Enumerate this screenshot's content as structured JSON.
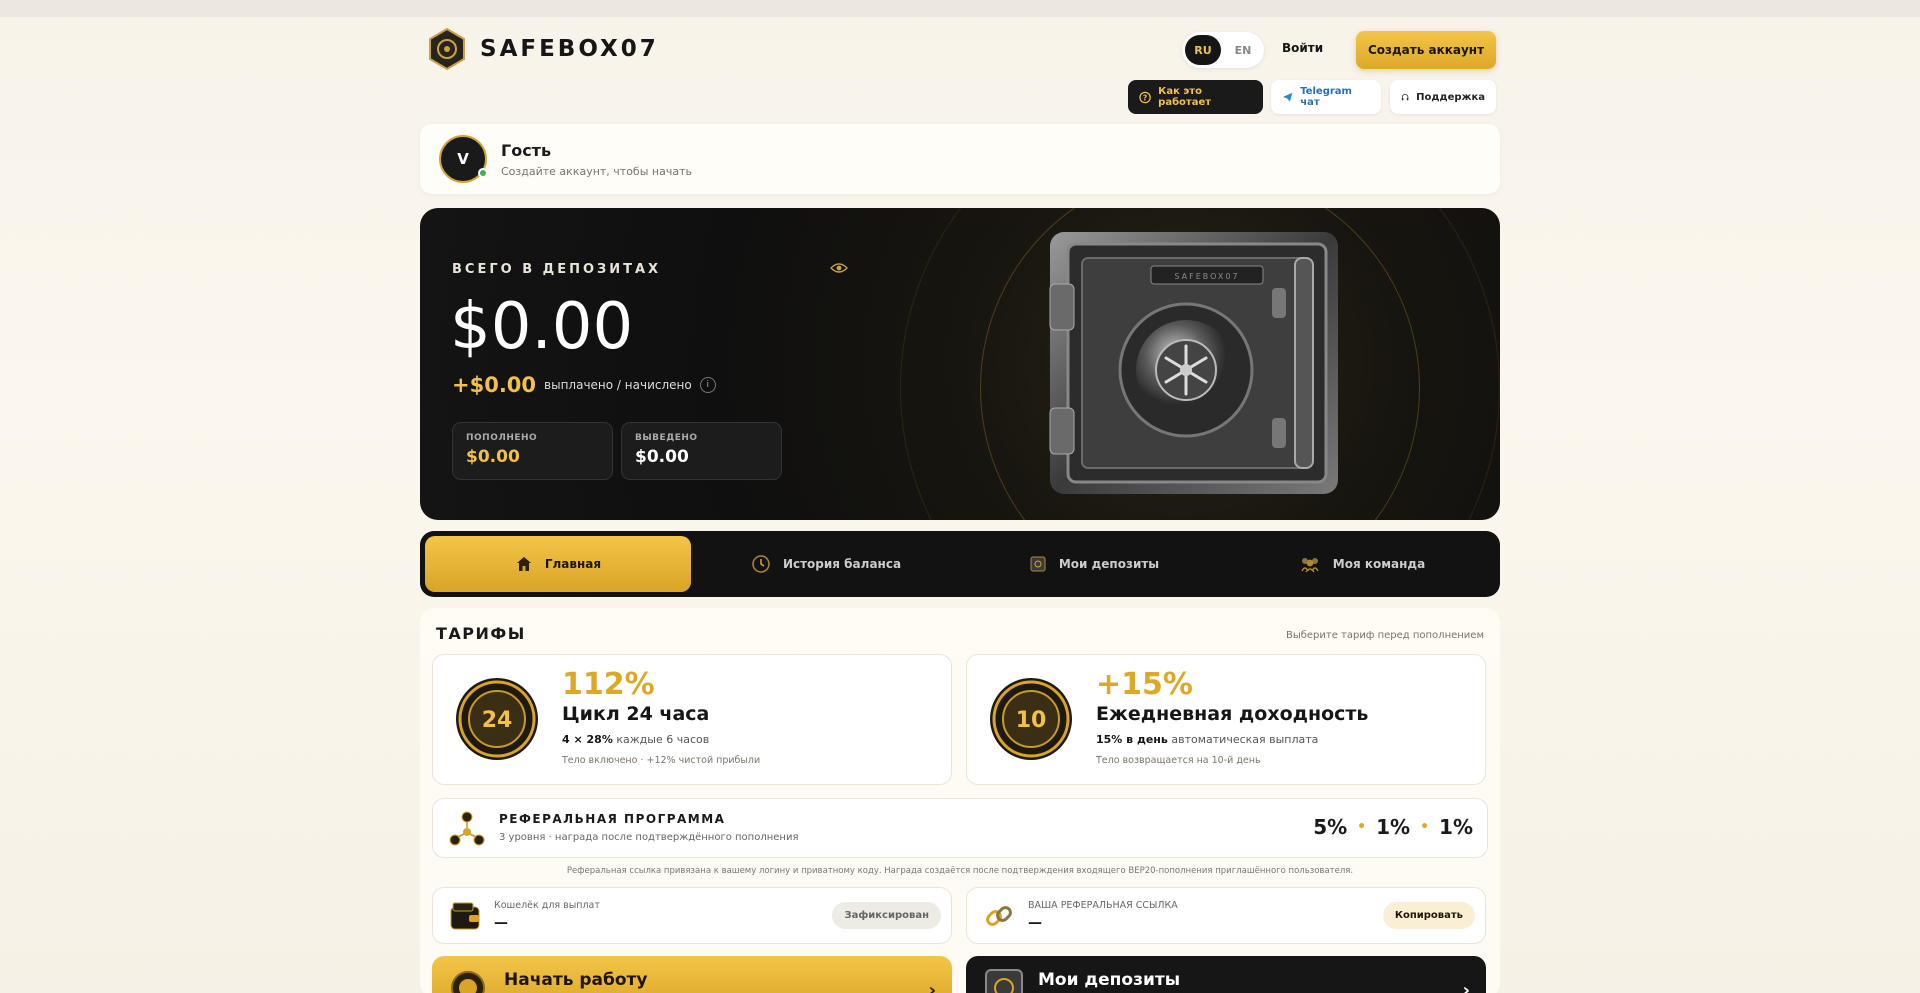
{
  "brand": {
    "name": "SAFEBOX07"
  },
  "header": {
    "lang": [
      "RU",
      "EN"
    ],
    "lang_active": "RU",
    "login": "Войти",
    "signup": "Создать аккаунт",
    "how": "Как это работает",
    "telegram": "Telegram чат",
    "support": "Поддержка"
  },
  "user": {
    "initial": "V",
    "name": "Гость",
    "sub": "Создайте аккаунт, чтобы начать"
  },
  "hero": {
    "label": "ВСЕГО В ДЕПОЗИТАХ",
    "amount": "$0.00",
    "paid": "+$0.00",
    "paid_text": "выплачено / начислено",
    "info": "i",
    "stats": [
      {
        "key": "ПОПОЛНЕНО",
        "value": "$0.00"
      },
      {
        "key": "ВЫВЕДЕНО",
        "value": "$0.00"
      }
    ],
    "safe_plate": "SAFEBOX07"
  },
  "tabs": [
    {
      "label": "Главная",
      "icon": "home-icon",
      "active": true
    },
    {
      "label": "История баланса",
      "icon": "history-icon",
      "active": false
    },
    {
      "label": "Мои депозиты",
      "icon": "safe-icon",
      "active": false
    },
    {
      "label": "Моя команда",
      "icon": "team-icon",
      "active": false
    }
  ],
  "tariffs": {
    "title": "ТАРИФЫ",
    "hint": "Выберите тариф перед пополнением",
    "items": [
      {
        "coin": "24",
        "pct": "112%",
        "name": "Цикл 24 часа",
        "line_b": "4 × 28%",
        "line": "каждые 6 часов",
        "foot": "Тело включено · +12% чистой прибыли"
      },
      {
        "coin": "10",
        "pct": "+15%",
        "name": "Ежедневная доходность",
        "line_b": "15% в день",
        "line": "автоматическая выплата",
        "foot": "Тело возвращается на 10-й день"
      }
    ]
  },
  "referral": {
    "title": "РЕФЕРАЛЬНАЯ ПРОГРАММА",
    "sub": "3 уровня · награда после подтверждённого пополнения",
    "levels": [
      "5%",
      "1%",
      "1%"
    ],
    "note": "Реферальная ссылка привязана к вашему логину и приватному коду. Награда создаётся после подтверждения входящего BEP20-пополнения приглашённого пользователя."
  },
  "wallet": {
    "label": "Кошелёк для выплат",
    "value": "—",
    "badge": "Зафиксирован"
  },
  "reflink": {
    "label": "ВАША РЕФЕРАЛЬНАЯ ССЫЛКА",
    "value": "—",
    "button": "Копировать"
  },
  "actions": {
    "start": "Начать работу",
    "deposits": "Мои депозиты",
    "chevron": "›"
  },
  "colors": {
    "gold": "#dca828",
    "dark": "#121212"
  }
}
